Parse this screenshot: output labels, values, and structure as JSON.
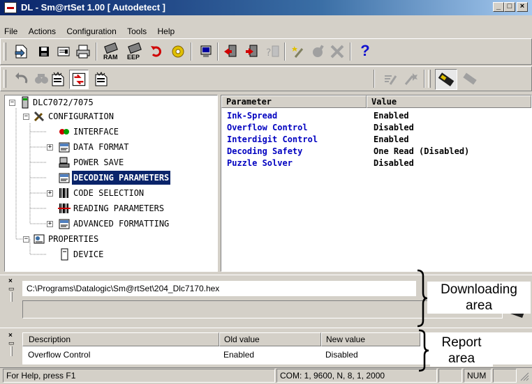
{
  "window": {
    "title": "DL - Sm@rtSet 1.00 [ Autodetect ]"
  },
  "menu": [
    {
      "label": "File",
      "u": "F"
    },
    {
      "label": "Actions",
      "u": "A"
    },
    {
      "label": "Configuration",
      "u": "C"
    },
    {
      "label": "Tools",
      "u": "T"
    },
    {
      "label": "Help",
      "u": "H"
    }
  ],
  "toolbar": {
    "ram_label": "RAM",
    "eep_label": "EEP",
    "help_glyph": "?"
  },
  "tree": {
    "root": "DLC7072/7075",
    "items": [
      {
        "label": "CONFIGURATION"
      },
      {
        "label": "INTERFACE"
      },
      {
        "label": "DATA FORMAT"
      },
      {
        "label": "POWER SAVE"
      },
      {
        "label": "DECODING PARAMETERS"
      },
      {
        "label": "CODE SELECTION"
      },
      {
        "label": "READING PARAMETERS"
      },
      {
        "label": "ADVANCED FORMATTING"
      },
      {
        "label": "PROPERTIES"
      },
      {
        "label": "DEVICE"
      }
    ]
  },
  "params": {
    "col_parameter": "Parameter",
    "col_value": "Value",
    "rows": [
      {
        "name": "Ink-Spread",
        "value": "Enabled"
      },
      {
        "name": "Overflow Control",
        "value": "Disabled"
      },
      {
        "name": "Interdigit Control",
        "value": "Enabled"
      },
      {
        "name": "Decoding Safety",
        "value": "One Read (Disabled)"
      },
      {
        "name": "Puzzle Solver",
        "value": "Disabled"
      }
    ]
  },
  "download": {
    "path": "C:\\Programs\\Datalogic\\Sm@rtSet\\204_Dlc7170.hex",
    "annotation_line1": "Downloading",
    "annotation_line2": "area"
  },
  "report": {
    "col_description": "Description",
    "col_old": "Old value",
    "col_new": "New value",
    "rows": [
      {
        "description": "Overflow Control",
        "old": "Enabled",
        "new": "Disabled"
      }
    ],
    "annotation_line1": "Report",
    "annotation_line2": "area"
  },
  "statusbar": {
    "help": "For Help, press F1",
    "com": "COM: 1, 9600, N, 8, 1, 2000",
    "num": "NUM"
  },
  "colors": {
    "title_blue": "#0a246a",
    "param_blue": "#0000c0",
    "face": "#d4d0c8"
  }
}
